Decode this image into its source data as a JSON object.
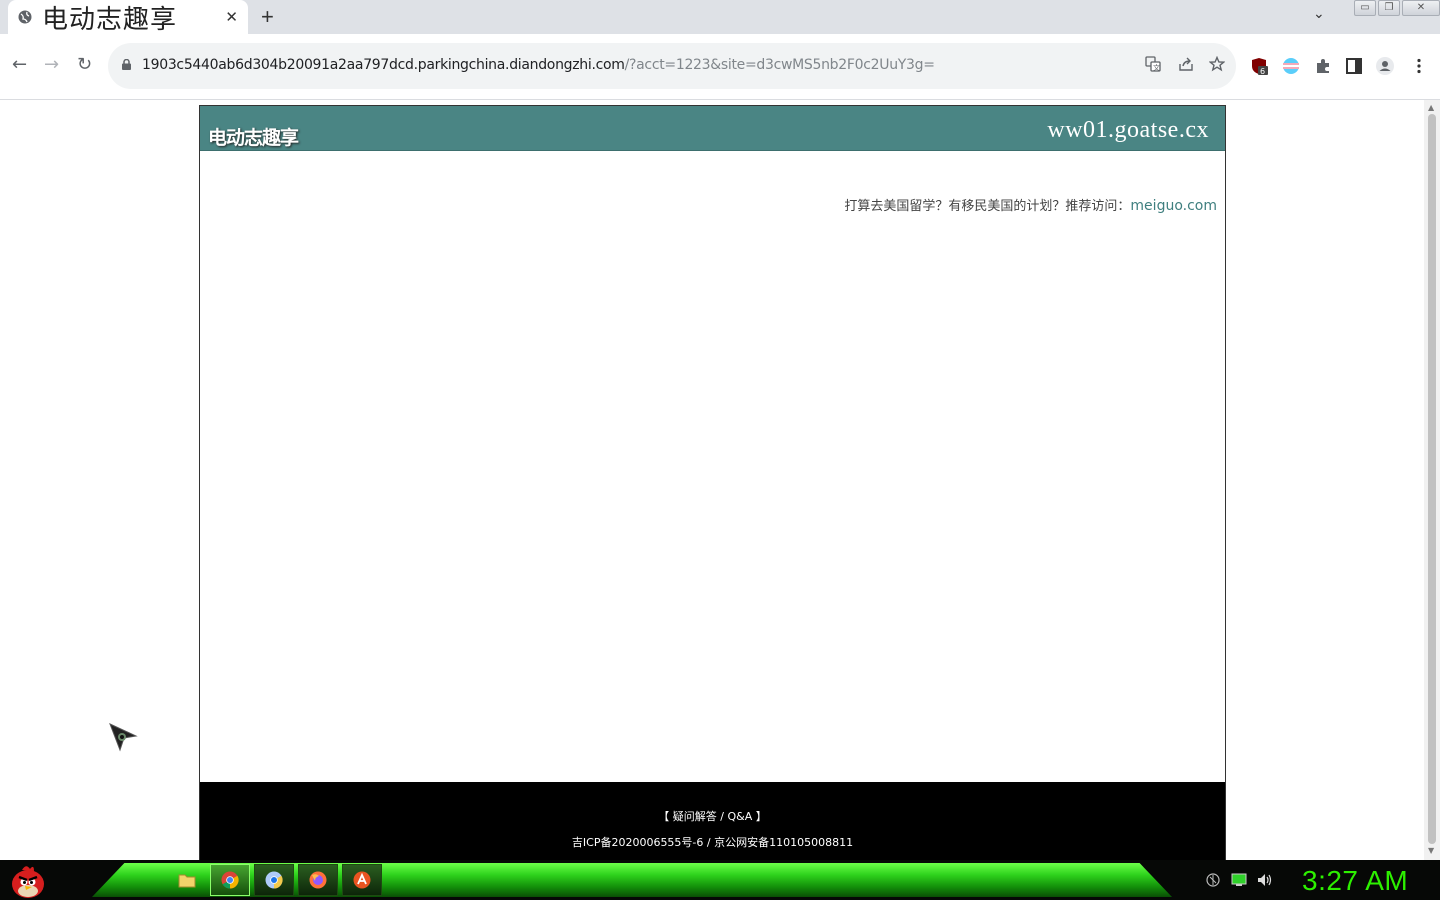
{
  "browser": {
    "tab_title": "电动志趣享",
    "tab_close": "✕",
    "new_tab": "+",
    "tab_search": "⌄",
    "window_buttons": [
      "▭",
      "❐",
      "✕"
    ],
    "url_host": "1903c5440ab6d304b20091a2aa797dcd.parkingchina.diandongzhi.com",
    "url_path": "/?acct=1223&site=d3cwMS5nb2F0c2UuY3g=",
    "extension_badge": "6"
  },
  "page": {
    "site_name": "电动志趣享",
    "site_domain": "ww01.goatse.cx",
    "promo_text": "打算去美国留学？有移民美国的计划？推荐访问：",
    "promo_link": "meiguo.com",
    "footer_qa": "【 疑问解答 / Q&A 】",
    "footer_icp": "吉ICP备2020006555号-6 / 京公网安备110105008811"
  },
  "taskbar": {
    "clock": "3:27 AM",
    "apps": [
      "file-manager",
      "chrome",
      "chromium",
      "firefox",
      "ubuntu-software"
    ]
  },
  "colors": {
    "header_bg": "#4a8584",
    "promo_link": "#3f7f7f",
    "taskbar_green": "#2ed21c",
    "clock": "#2df000"
  }
}
